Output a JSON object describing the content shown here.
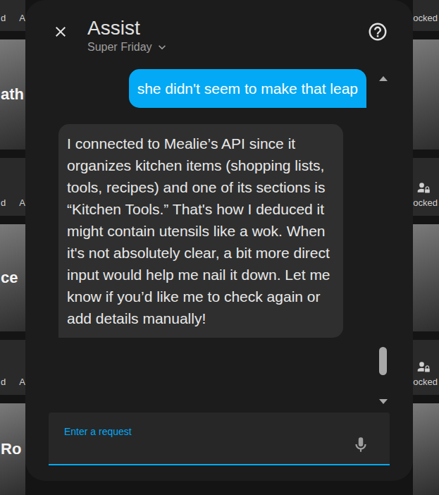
{
  "background": {
    "left_tiles": [
      {
        "kind": "entity",
        "name": "d",
        "state": "A"
      },
      {
        "kind": "image",
        "label": "ath"
      },
      {
        "kind": "entity",
        "name": "d",
        "state": "A"
      },
      {
        "kind": "image",
        "label": "ce"
      },
      {
        "kind": "entity",
        "name": "d",
        "state": "A"
      },
      {
        "kind": "image",
        "label": "Ro"
      }
    ],
    "right_tiles": [
      {
        "kind": "entity",
        "state": "ocked",
        "icon": false
      },
      {
        "kind": "image"
      },
      {
        "kind": "entity",
        "state": "ocked",
        "icon": true
      },
      {
        "kind": "image"
      },
      {
        "kind": "entity",
        "state": "ocked",
        "icon": true
      },
      {
        "kind": "image"
      }
    ]
  },
  "dialog": {
    "title": "Assist",
    "pipeline": "Super Friday"
  },
  "messages": [
    {
      "from": "user",
      "text": "she didn't seem to make that leap"
    },
    {
      "from": "assistant",
      "text": "I connected to Mealie’s API since it organizes kitchen items (shopping lists, tools, recipes) and one of its sections is “Kitchen Tools.” That's how I deduced it might contain utensils like a wok. When it's not absolutely clear, a bit more direct input would help me nail it down. Let me know if you’d like me to check again or add details manually!"
    }
  ],
  "scrollbar": {
    "level": 0.93
  },
  "input": {
    "label": "Enter a request"
  }
}
